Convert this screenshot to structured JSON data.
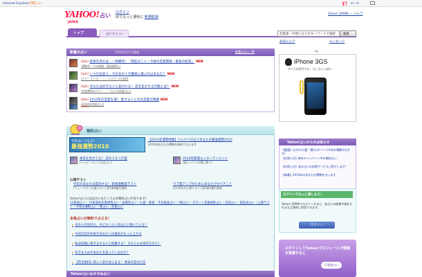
{
  "topbar": {
    "ie_notice": "Internet Explorer",
    "ie_notice_rest": "が新しい",
    "yahoo_icon": "Y!",
    "mail_label": "メール",
    "mail_icon": "envelope-icon"
  },
  "header": {
    "logo": "YAHOO!",
    "logo_sub": "JAPAN",
    "service": "占い",
    "login_line1": "ログイン",
    "login_line2": "IDでもっと便利に",
    "login_register": "新規取得",
    "right_links": "Yahoo! JAPAN ・ ヘルプ"
  },
  "nav": {
    "tab_top": "トップ",
    "tab_fortune": "占いメニュー",
    "search_placeholder": "恋愛運・片想いなどのキーワードで検索",
    "search_button": "検索",
    "help_left": "お気に入り",
    "help_right": "メッセージ"
  },
  "new_section": {
    "title": "新着の占い",
    "date": "2010年1月7日更新",
    "more": "新着の占い一覧",
    "new_badge": "NEW",
    "items": [
      {
        "cat": "[有料]",
        "title": "結果を見れば…一目瞭然！『現在の二人・今後の恋愛関係・最後の結末』",
        "sub": "(運勢学・今の物語「真相解明」)"
      },
      {
        "cat": "[有料]",
        "title": "いつか出会う、今のあの人が最後に選ぶのはあなた？",
        "sub": "(ナデ・マーガ ・・・ハッピーの法則)"
      },
      {
        "cat": "[有料]",
        "title": "あなたは好きな人と変われる！ 恋を生かせる行動とは？",
        "sub": "(恋愛関係の二人 ・・・大人の恋愛占い)"
      },
      {
        "cat": "[有料]",
        "title": "2010年の恋愛を運！ 愛する人との大恋愛の時期",
        "sub": "(2010年恋愛占い)"
      },
      {
        "cat": "[有料]",
        "title": "",
        "sub": ""
      }
    ]
  },
  "free_section": {
    "title": "無料占い",
    "icon": "crystal-ball-icon",
    "banner_small": "今年はどうなる？",
    "banner_big": "最強運勢2010",
    "banner_line": "【2010年運勢特集】ジュウリが占うあなたの最強運勢2010",
    "banner_desc": "2010年あなたの運勢を無料で占います",
    "rows": [
      {
        "title": "本音を見せてる？ 恋のうそつき度",
        "sub": "(ハッピーエンドな恋占い)"
      },
      {
        "title": "2010年開運エンターテイメント",
        "sub": "(猫ジュウリの運に勝つ)"
      }
    ],
    "psy_head": "心理テスト",
    "psy_rows": [
      {
        "title": "今年のあなたは成功する？ 新請過剰度テスト",
        "sub": "(ウェーブロー心理テスト) 第1章8番目更新"
      },
      {
        "title": "ラブ運アップのためにあなたがすべきこと",
        "sub": "(Gratticの心理テスト) 第2章4番目更新"
      }
    ],
    "links_lead": "Yahoo!占いにはほかにもたくさんの無料占いがあります！",
    "links": "12星座占い｜12星座別恋愛相性占い｜血液型占い｜九星・紫星・干支星座占い｜9星占い｜タロット恋愛相性占い｜名前占い｜誕生日占い｜心理テスト｜今年の運勢占い｜夢占い｜恋愛占い"
  },
  "paid_section": {
    "title": "本格占いが無料で占える！",
    "items": [
      "あの人の気持ち、今どれくらいあなたに傾いている？",
      "今日の恋の中身をあなたへの運気がもっと上がる",
      "私は結婚に適するする人と結婚する？ それともお金持ちの人？",
      "好きな人は今あなたを思っているのか？",
      "【完全無料】新しい恋がはじまる！ 明日の恋の行方"
    ],
    "next_head": "Yahoo!占いおすすめ占い"
  },
  "sidebar": {
    "ad_label": "PR",
    "ad_title": "iPhone 3GS",
    "ad_copy": "すべての世代でも、らしさいっぱい",
    "ad_icon": "apple-logo-icon",
    "notice_head": "Yahoo!占いからのお知らせ",
    "notices": [
      "【重要】ひかのり(星・運)スタートで今年の運勢が分かる！",
      "【お知らせ】新年キャンペーン中の無料占い",
      "【お知らせ】恋の占いの診断サービスご紹介します！",
      "【新着】2010年のあなたの運勢を占います"
    ],
    "login_head": "ログインでもっと楽しもう！",
    "login_text": "Yahoo! JAPANでログインすると、各占いの結果が保存されるなど便利に利用できます。",
    "login_button": "ログイン",
    "profile_text": "ログインしてYahoo!プロフィールで情報を登録すると",
    "profile_badge": "12星座占い"
  }
}
